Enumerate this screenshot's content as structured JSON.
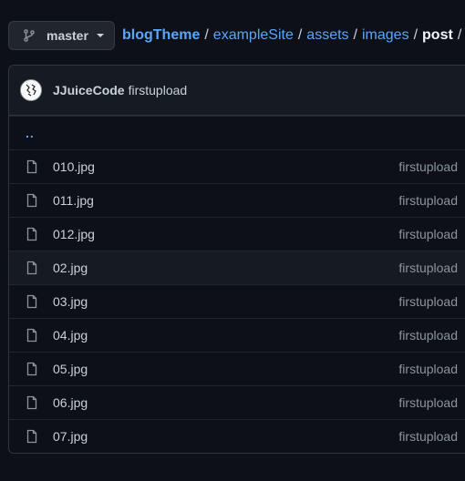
{
  "branch": {
    "label": "master",
    "icon": "git-branch-icon"
  },
  "breadcrumb": {
    "repo": "blogTheme",
    "path": [
      "exampleSite",
      "assets",
      "images"
    ],
    "current": "post",
    "separator": "/"
  },
  "commit": {
    "author": "JJuiceCode",
    "message": "firstupload"
  },
  "parent_link": "..",
  "files": [
    {
      "name": "010.jpg",
      "commit": "firstupload"
    },
    {
      "name": "011.jpg",
      "commit": "firstupload"
    },
    {
      "name": "012.jpg",
      "commit": "firstupload"
    },
    {
      "name": "02.jpg",
      "commit": "firstupload"
    },
    {
      "name": "03.jpg",
      "commit": "firstupload"
    },
    {
      "name": "04.jpg",
      "commit": "firstupload"
    },
    {
      "name": "05.jpg",
      "commit": "firstupload"
    },
    {
      "name": "06.jpg",
      "commit": "firstupload"
    },
    {
      "name": "07.jpg",
      "commit": "firstupload"
    }
  ],
  "colors": {
    "background": "#0d1117",
    "link": "#58a6ff",
    "text": "#c9d1d9",
    "muted": "#8b949e",
    "border": "#30363d"
  }
}
